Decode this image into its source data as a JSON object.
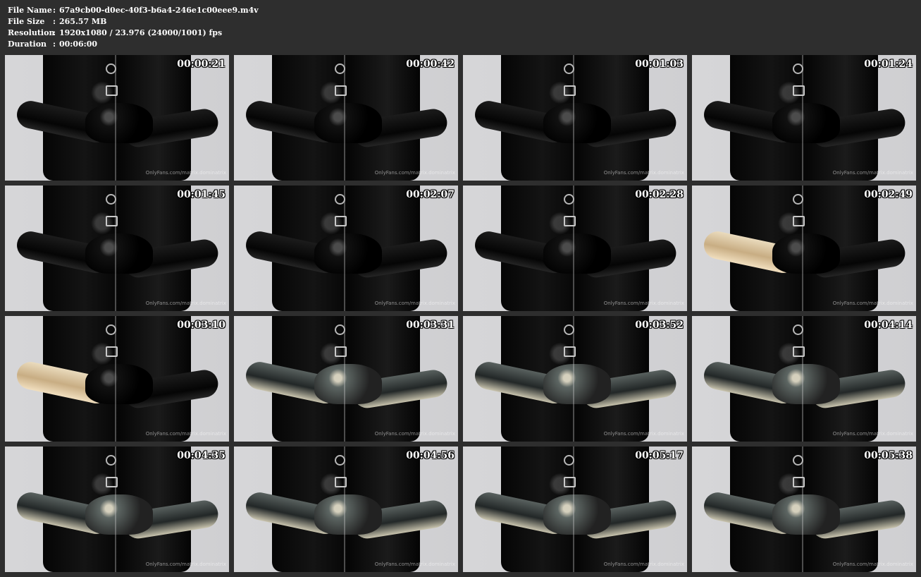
{
  "file_info": {
    "rows": [
      {
        "label": "File Name",
        "separator": ":",
        "value": "67a9cb00-d0ec-40f3-b6a4-246e1c00eee9.m4v"
      },
      {
        "label": "File Size",
        "separator": ":",
        "value": "265.57 MB"
      },
      {
        "label": "Resolution",
        "separator": ":",
        "value": "1920x1080 / 23.976 (24000/1001) fps"
      },
      {
        "label": "Duration",
        "separator": ":",
        "value": "00:06:00"
      }
    ]
  },
  "thumbnails": [
    {
      "timestamp": "00:00:21",
      "watermark": "OnlyFans.com/matrix.dominatrix",
      "style": "black"
    },
    {
      "timestamp": "00:00:42",
      "watermark": "OnlyFans.com/matrix.dominatrix",
      "style": "black"
    },
    {
      "timestamp": "00:01:03",
      "watermark": "OnlyFans.com/matrix.dominatrix",
      "style": "black"
    },
    {
      "timestamp": "00:01:24",
      "watermark": "OnlyFans.com/matrix.dominatrix",
      "style": "black"
    },
    {
      "timestamp": "00:01:45",
      "watermark": "OnlyFans.com/matrix.dominatrix",
      "style": "black"
    },
    {
      "timestamp": "00:02:07",
      "watermark": "OnlyFans.com/matrix.dominatrix",
      "style": "black"
    },
    {
      "timestamp": "00:02:28",
      "watermark": "OnlyFans.com/matrix.dominatrix",
      "style": "black"
    },
    {
      "timestamp": "00:02:49",
      "watermark": "OnlyFans.com/matrix.dominatrix",
      "style": "fleshy"
    },
    {
      "timestamp": "00:03:10",
      "watermark": "OnlyFans.com/matrix.dominatrix",
      "style": "fleshy"
    },
    {
      "timestamp": "00:03:31",
      "watermark": "OnlyFans.com/matrix.dominatrix",
      "style": "translucent"
    },
    {
      "timestamp": "00:03:52",
      "watermark": "OnlyFans.com/matrix.dominatrix",
      "style": "translucent"
    },
    {
      "timestamp": "00:04:14",
      "watermark": "OnlyFans.com/matrix.dominatrix",
      "style": "translucent"
    },
    {
      "timestamp": "00:04:35",
      "watermark": "OnlyFans.com/matrix.dominatrix",
      "style": "translucent"
    },
    {
      "timestamp": "00:04:56",
      "watermark": "OnlyFans.com/matrix.dominatrix",
      "style": "translucent"
    },
    {
      "timestamp": "00:05:17",
      "watermark": "OnlyFans.com/matrix.dominatrix",
      "style": "translucent"
    },
    {
      "timestamp": "00:05:38",
      "watermark": "OnlyFans.com/matrix.dominatrix",
      "style": "translucent"
    }
  ]
}
